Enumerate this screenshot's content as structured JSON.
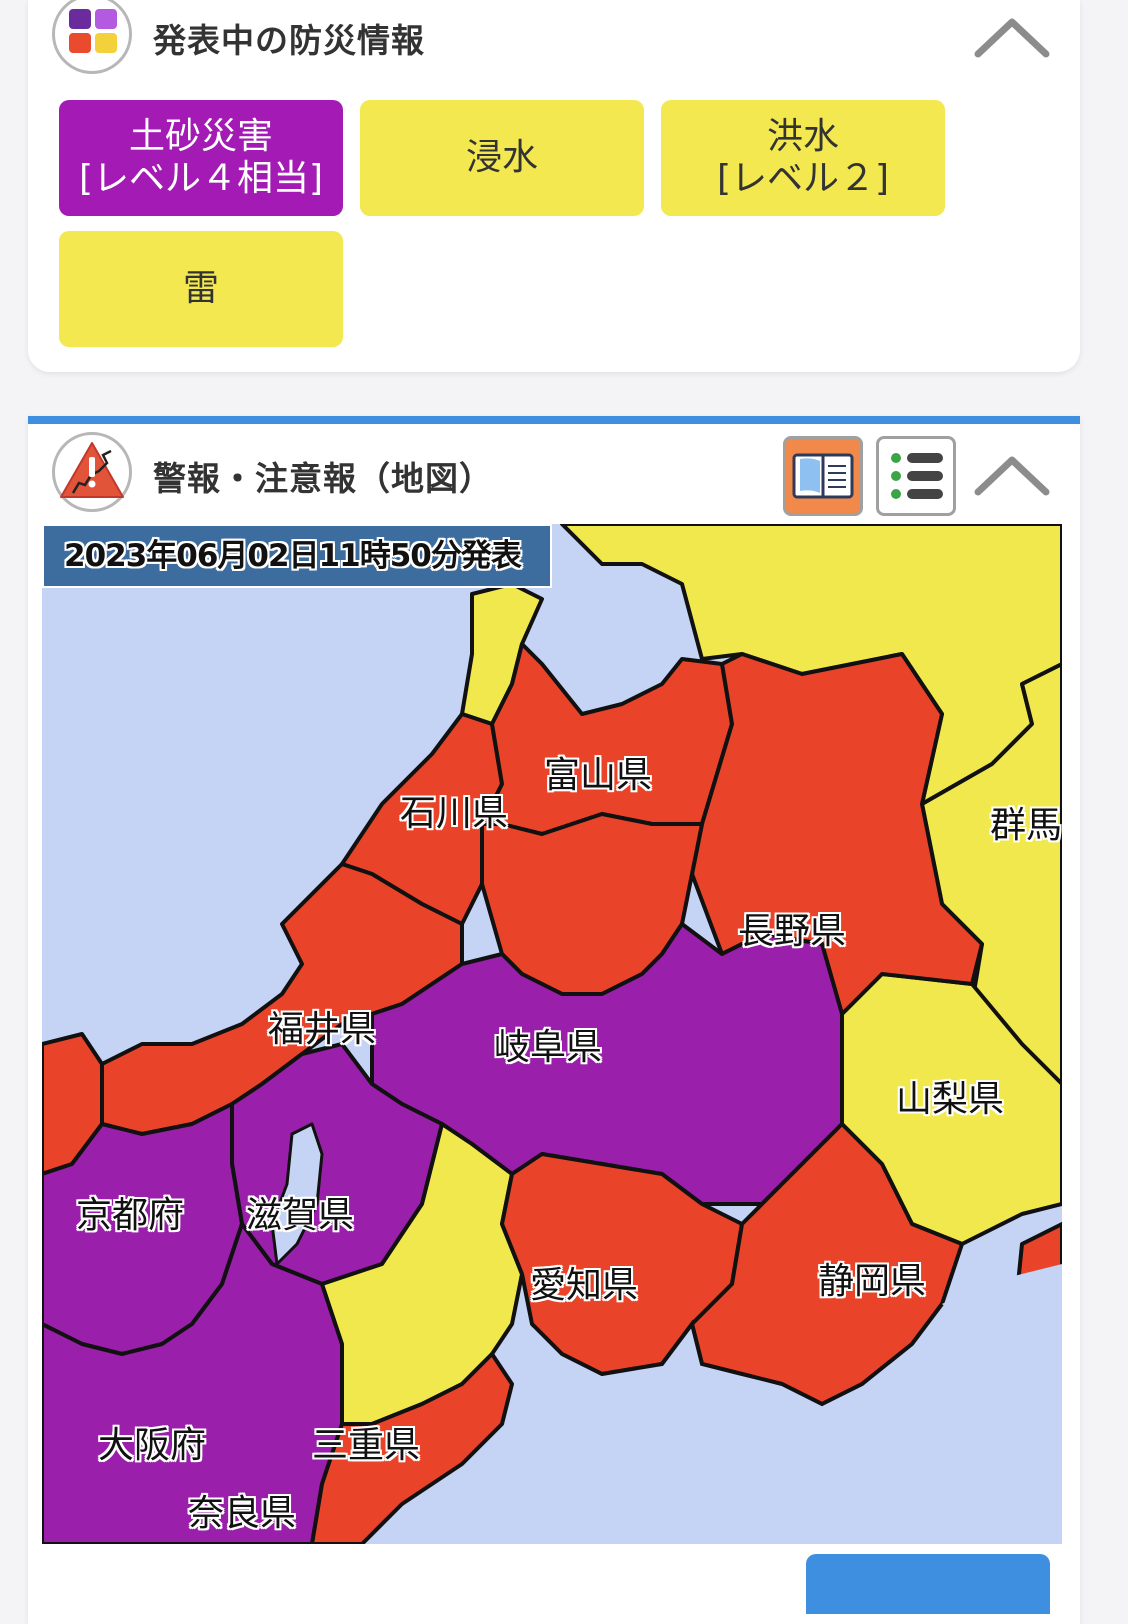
{
  "alerts_card": {
    "title": "発表中の防災情報",
    "buttons": [
      {
        "label": "土砂災害\n[レベル４相当]",
        "level": "purple"
      },
      {
        "label": "浸水",
        "level": "yellow"
      },
      {
        "label": "洪水\n[レベル２]",
        "level": "yellow"
      },
      {
        "label": "雷",
        "level": "yellow"
      }
    ]
  },
  "map_card": {
    "title": "警報・注意報（地図）",
    "issued": "2023年06月02日11時50分発表",
    "prefectures": {
      "toyama": "富山県",
      "ishikawa": "石川県",
      "gunma": "群馬",
      "nagano": "長野県",
      "fukui": "福井県",
      "gifu": "岐阜県",
      "yamanashi": "山梨県",
      "kyoto": "京都府",
      "shiga": "滋賀県",
      "aichi": "愛知県",
      "shizuoka": "静岡県",
      "osaka": "大阪府",
      "mie": "三重県",
      "nara": "奈良県"
    }
  },
  "colors": {
    "warning_red": "#e9442a",
    "heavy_purple": "#9a1fab",
    "advisory_yellow": "#f1e84e",
    "sea": "#c5d3f5",
    "accent_blue": "#3f8fe0"
  }
}
